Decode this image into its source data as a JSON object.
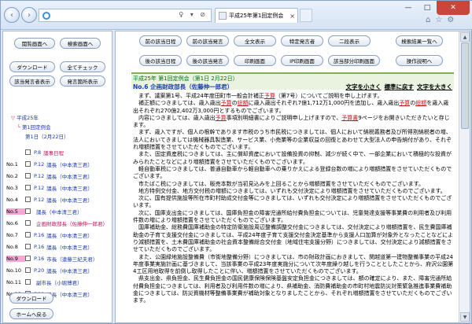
{
  "browser": {
    "tab_title": "平成25年第1回定例会（第…",
    "addr_icons": "♀ ▾ ⊘",
    "tab_close": "×",
    "nav_back": "‹",
    "nav_fwd": "›",
    "win_min": "—",
    "win_max": "□",
    "win_close": "✕",
    "tools": [
      "⌂",
      "☆",
      "⚙"
    ],
    "icons": {
      "back": "back-arrow-icon",
      "forward": "forward-arrow-icon",
      "home": "home-icon",
      "favorites": "star-icon",
      "settings": "gear-icon",
      "address_logo": "ie-logo-icon"
    }
  },
  "left": {
    "buttons": [
      "閲覧画面へ",
      "検索画面へ",
      "ダウンロード",
      "全てチェック",
      "該当発言者表示",
      "発言箇所表示",
      "ダウンロード",
      "ホームへ戻る"
    ],
    "tree": {
      "root": "平成25年",
      "meeting": "第1回定例会",
      "day": "第1日（2月22日）"
    },
    "rows": [
      {
        "num": "",
        "seg": "P.8",
        "name": "議事日程"
      },
      {
        "num": "No.1",
        "seg": "P.12",
        "name": "議長（中本清三君）"
      },
      {
        "num": "No.2",
        "seg": "P.12",
        "name": "議長（中本清三君）"
      },
      {
        "num": "No.3",
        "seg": "P.12",
        "name": "議長（中本清三君）"
      },
      {
        "num": "No.4",
        "seg": "P.12",
        "name": "議長（中本清三君）"
      },
      {
        "num": "No.5",
        "seg": "",
        "name": "議長（中本清三君）"
      },
      {
        "num": "No.6",
        "seg": "",
        "name": "企画財政部長（佐藤伸一郎君）"
      },
      {
        "num": "No.7",
        "seg": "P.16",
        "name": "議長（中本清三君）"
      },
      {
        "num": "No.8",
        "seg": "P.16",
        "name": "議長（中本清三君）"
      },
      {
        "num": "No.9",
        "seg": "P.16",
        "name": "市長（遠藤三紀夫君）"
      },
      {
        "num": "No.10",
        "seg": "P.20",
        "name": "議長（中本清三君）"
      },
      {
        "num": "No.11",
        "seg": "",
        "name": "副市長（小堀博君）"
      },
      {
        "num": "No.12",
        "seg": "P.20",
        "name": "議長（中本清三君）"
      }
    ]
  },
  "right": {
    "buttons_row1": [
      "前の該当日程",
      "前の該当発言",
      "全文表示",
      "特定発言者",
      "二段表示",
      "検索結果一覧へ"
    ],
    "buttons_row2": [
      "後の該当日程",
      "後の該当発言",
      "印刷画面",
      "IP印刷画面",
      "該当部分印刷画面",
      "操作説明へ"
    ],
    "header_line1": "平成25年 第1回定例会（第1日 2月22日）",
    "header_line2": "No.6 企画財政部長（佐藤伸一郎君）",
    "text_size": [
      "文字を小さく",
      "標準に戻す",
      "文字を大きく"
    ],
    "paragraphs": [
      "まず、議案第1号、平成24年度田町市一般会計補正予算（第7号）についてご説明を申し上げます。",
      "補正額につきましては、歳入歳出予算の総額に歳入歳出それぞれ7億1,712万1,000円を追加し、歳入歳出予算の総額を歳入歳出それぞれ270億2,402万3,000円とするものでございます。",
      "内容につきましては、歳入歳出予算事項別明細書によりご説明申し上げますので、予算書9ページをお開きいただきたいと存じます。",
      "まず、歳入ですが、個人の根幹であります市税のうち市民税につきましては、個人において納税義務者及び所得割納税者の増、法人においてきましては機械器具製造業、サービス業、小売業等の企業収益の回復とあわせて大型法人の申告納付があり、それぞれ増額措置をさせていただくものでございます。",
      "また、固定資産税につきましては、主に償却資産において設備投資の抑制、減少が続く中で、一部企業において積極的な投資がみられたことなどにより増額措置をさせていただくものでございます。",
      "軽自動車税につきましては、普通自動車から軽自動車への乗りかえによる登録台数の増により増額措置をさせていただくものでございます。",
      "市たばこ税につきましては、販売本数が当初見込みを上回ることから増額措置をさせていただくものでございます。",
      "地方特例交付金、地方交付税の増額につきましては、いずれも交付決定により増額措置をさせていただくものでございます。",
      "次に、国有提供施設等所在市町村助成交付金等につきましては、いずれも交付決定により増額措置をさせていただくものでございます。",
      "次に、国庫支出金につきましては、国庫負担金の障害児通所給付費負担金については、児童発達支援等事業費の利用者及び利用件数の増により増額措置をさせていただくものでございます。",
      "国庫補助金、総務費国庫補助金の特定防衛施設周辺整備調整交付金につきましては、交付決定により増額措置を、民生費国庫補助金の子育て支援交付金につきましては、平成24年度子育て支援交付金決定基準から支援人口加算が対象外となったことなどにより減額措置を、土木費国庫補助金の社会資本整備総合交付金（地域住宅支援分野）につきましては、交付決定により減額措置をさせていただくものでございます。",
      "また、公園緑地施設整備費（市街地整備分野）につきましては、市の財政計画におきまして、関越道第一建物整備事業の平成24年度事業実施計画に基づきまして、当該事業の平成23年度実施分について次年度繰り越しを行うこととしたことから、府沢公園第4工区用地取得を前倒し取得したことに伴い、増額措置をさせていただくものでございます。",
      "県支出金、県負担金、民生費負担金の国民健康保険保険基盤安定負担金につきましては、額の確定により、また、障害児通所給付費負担金につきましては、利用者及び利用件数の増により、県補助金、消防費補助金の市町村地震防災対策緊急推進事業費補助金につきましては、防災資機材等整備事業費が補助対象となりましたことから、それぞれ増額措置をさせていただくものでございます。"
    ],
    "red_words": [
      "予算",
      "総額",
      "予算書"
    ]
  }
}
